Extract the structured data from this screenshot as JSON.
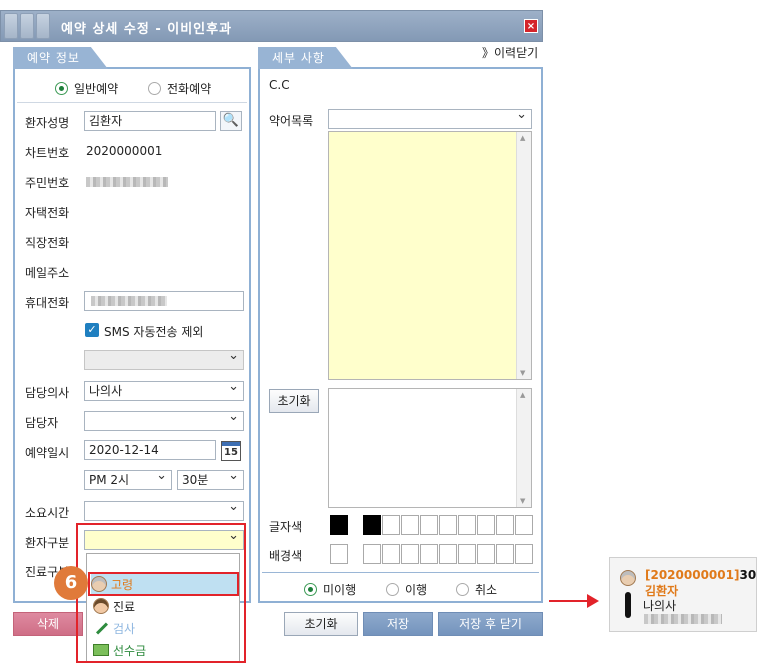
{
  "window": {
    "title": "예약 상세 수정 - 이비인후과",
    "close_label": "×"
  },
  "history_link": "》이력닫기",
  "left_panel": {
    "tab": "예약 정보",
    "reservation_types": [
      "일반예약",
      "전화예약"
    ],
    "selected_reservation_type": "일반예약",
    "fields": {
      "patient_name_label": "환자성명",
      "patient_name_value": "김환자",
      "chart_no_label": "차트번호",
      "chart_no_value": "2020000001",
      "resident_no_label": "주민번호",
      "home_phone_label": "자택전화",
      "work_phone_label": "직장전화",
      "email_label": "메일주소",
      "mobile_label": "휴대전화",
      "sms_exclude_label": "SMS 자동전송 제외",
      "doctor_label": "담당의사",
      "doctor_value": "나의사",
      "staff_label": "담당자",
      "datetime_label": "예약일시",
      "date_value": "2020-12-14",
      "calendar_day": "15",
      "hour_value": "PM 2시",
      "minute_value": "30분",
      "duration_label": "소요시간",
      "patient_type_label": "환자구분",
      "partial_label": "진료구분"
    }
  },
  "right_panel": {
    "tab": "세부 사항",
    "cc_label": "C.C",
    "abbrev_label": "약어목록",
    "reset_label": "초기화",
    "font_color_label": "글자색",
    "bg_color_label": "배경색",
    "status_options": [
      "미이행",
      "이행",
      "취소"
    ],
    "selected_status": "미이행"
  },
  "buttons": {
    "delete": "삭제",
    "reset": "초기화",
    "save": "저장",
    "save_close": "저장 후 닫기"
  },
  "dropdown": {
    "items": [
      {
        "label": "고령",
        "icon": "elderly-face-icon",
        "color": "#e07a1a"
      },
      {
        "label": "진료",
        "icon": "patient-face-icon",
        "color": "#222222"
      },
      {
        "label": "검사",
        "icon": "syringe-icon",
        "color": "#8fb7e0"
      },
      {
        "label": "선수금",
        "icon": "money-icon",
        "color": "#2e8b3e"
      }
    ]
  },
  "step_badge": "6",
  "callout": {
    "chart_no": "[2020000001]",
    "age": "30",
    "name": "김환자",
    "doctor": "나의사"
  },
  "colors": {
    "accent": "#98b4d4",
    "highlight": "#e2232a",
    "badge": "#e07a3a",
    "memo_bg": "#ffffcc"
  }
}
